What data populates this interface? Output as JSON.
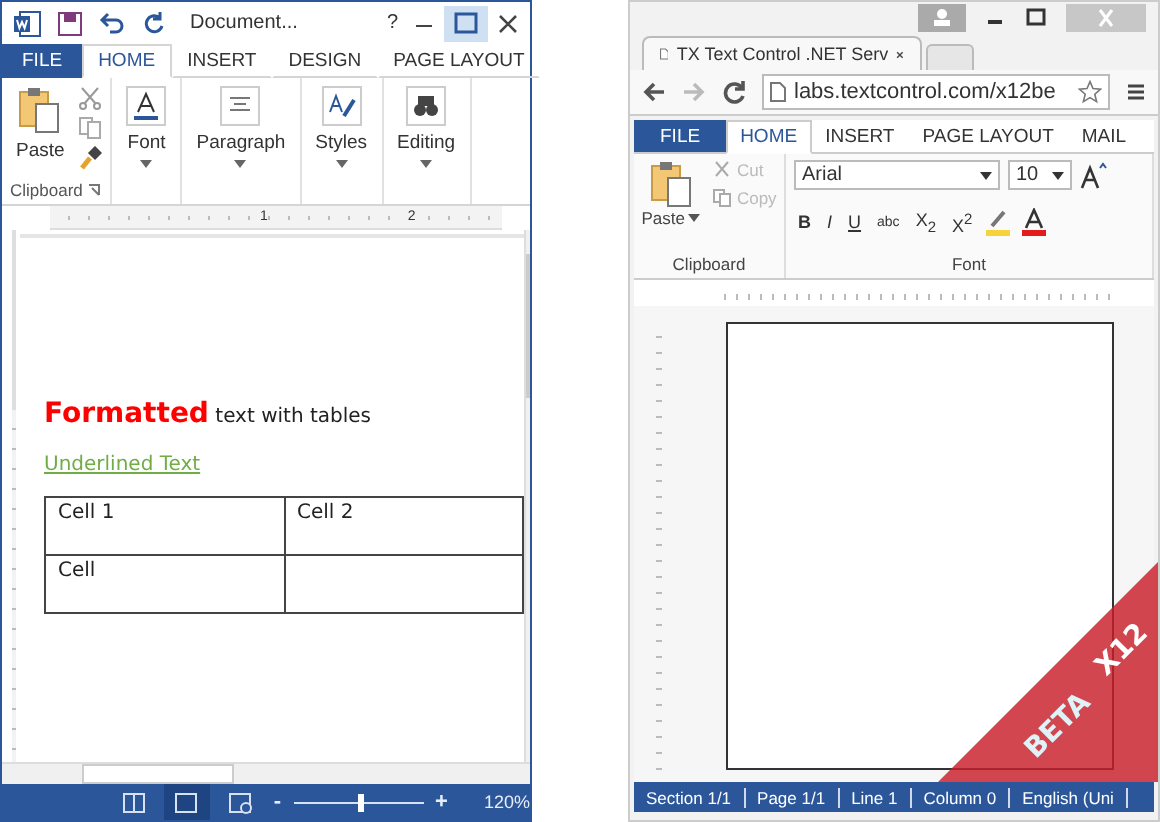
{
  "word": {
    "title": "Document...",
    "help": "?",
    "tabs": [
      {
        "label": "FILE",
        "kind": "file",
        "selected": false
      },
      {
        "label": "HOME",
        "kind": "tab",
        "selected": true
      },
      {
        "label": "INSERT",
        "kind": "tab",
        "selected": false
      },
      {
        "label": "DESIGN",
        "kind": "tab",
        "selected": false
      },
      {
        "label": "PAGE LAYOUT",
        "kind": "tab",
        "selected": false
      }
    ],
    "paste": "Paste",
    "clipboard_label": "Clipboard",
    "groups": [
      {
        "label": "Font",
        "kind": "font"
      },
      {
        "label": "Paragraph",
        "kind": "paragraph"
      },
      {
        "label": "Styles",
        "kind": "styles"
      },
      {
        "label": "Editing",
        "kind": "editing"
      }
    ],
    "ruler": [
      "1",
      "2"
    ],
    "document": {
      "emphasis": "Formatted",
      "text": "text with tables",
      "link": "Underlined Text",
      "table": [
        {
          "cells": [
            "Cell 1",
            "Cell 2"
          ]
        },
        {
          "cells": [
            "Cell"
          ]
        }
      ]
    },
    "views": [
      {
        "kind": "read",
        "selected": false
      },
      {
        "kind": "print",
        "selected": true
      },
      {
        "kind": "web",
        "selected": false
      }
    ],
    "zoom": {
      "minus": "-",
      "plus": "+",
      "level": 0.52,
      "reading": "120%"
    }
  },
  "browser": {
    "tab_title": "TX Text Control .NET Serv",
    "url": "labs.textcontrol.com/x12be",
    "tabs": [
      {
        "label": "FILE",
        "kind": "file",
        "selected": false
      },
      {
        "label": "HOME",
        "kind": "tab",
        "selected": true
      },
      {
        "label": "INSERT",
        "kind": "tab",
        "selected": false
      },
      {
        "label": "PAGE LAYOUT",
        "kind": "tab",
        "selected": false
      },
      {
        "label": "MAIL",
        "kind": "tab",
        "selected": false
      }
    ],
    "paste": "Paste",
    "cut": {
      "label": "Cut",
      "disabled": true
    },
    "copy": {
      "label": "Copy",
      "disabled": true
    },
    "clipboard_label": "Clipboard",
    "font": "Arial",
    "size": "10",
    "format": [
      "B",
      "I",
      "U",
      "abc",
      "X$_{2}$",
      "X$^{2}$"
    ],
    "font_label": "Font",
    "status": [
      "Section 1/1",
      "Page 1/1",
      "Line 1",
      "Column 0",
      "English (Uni"
    ],
    "badge": [
      "X12",
      "BETA"
    ]
  }
}
